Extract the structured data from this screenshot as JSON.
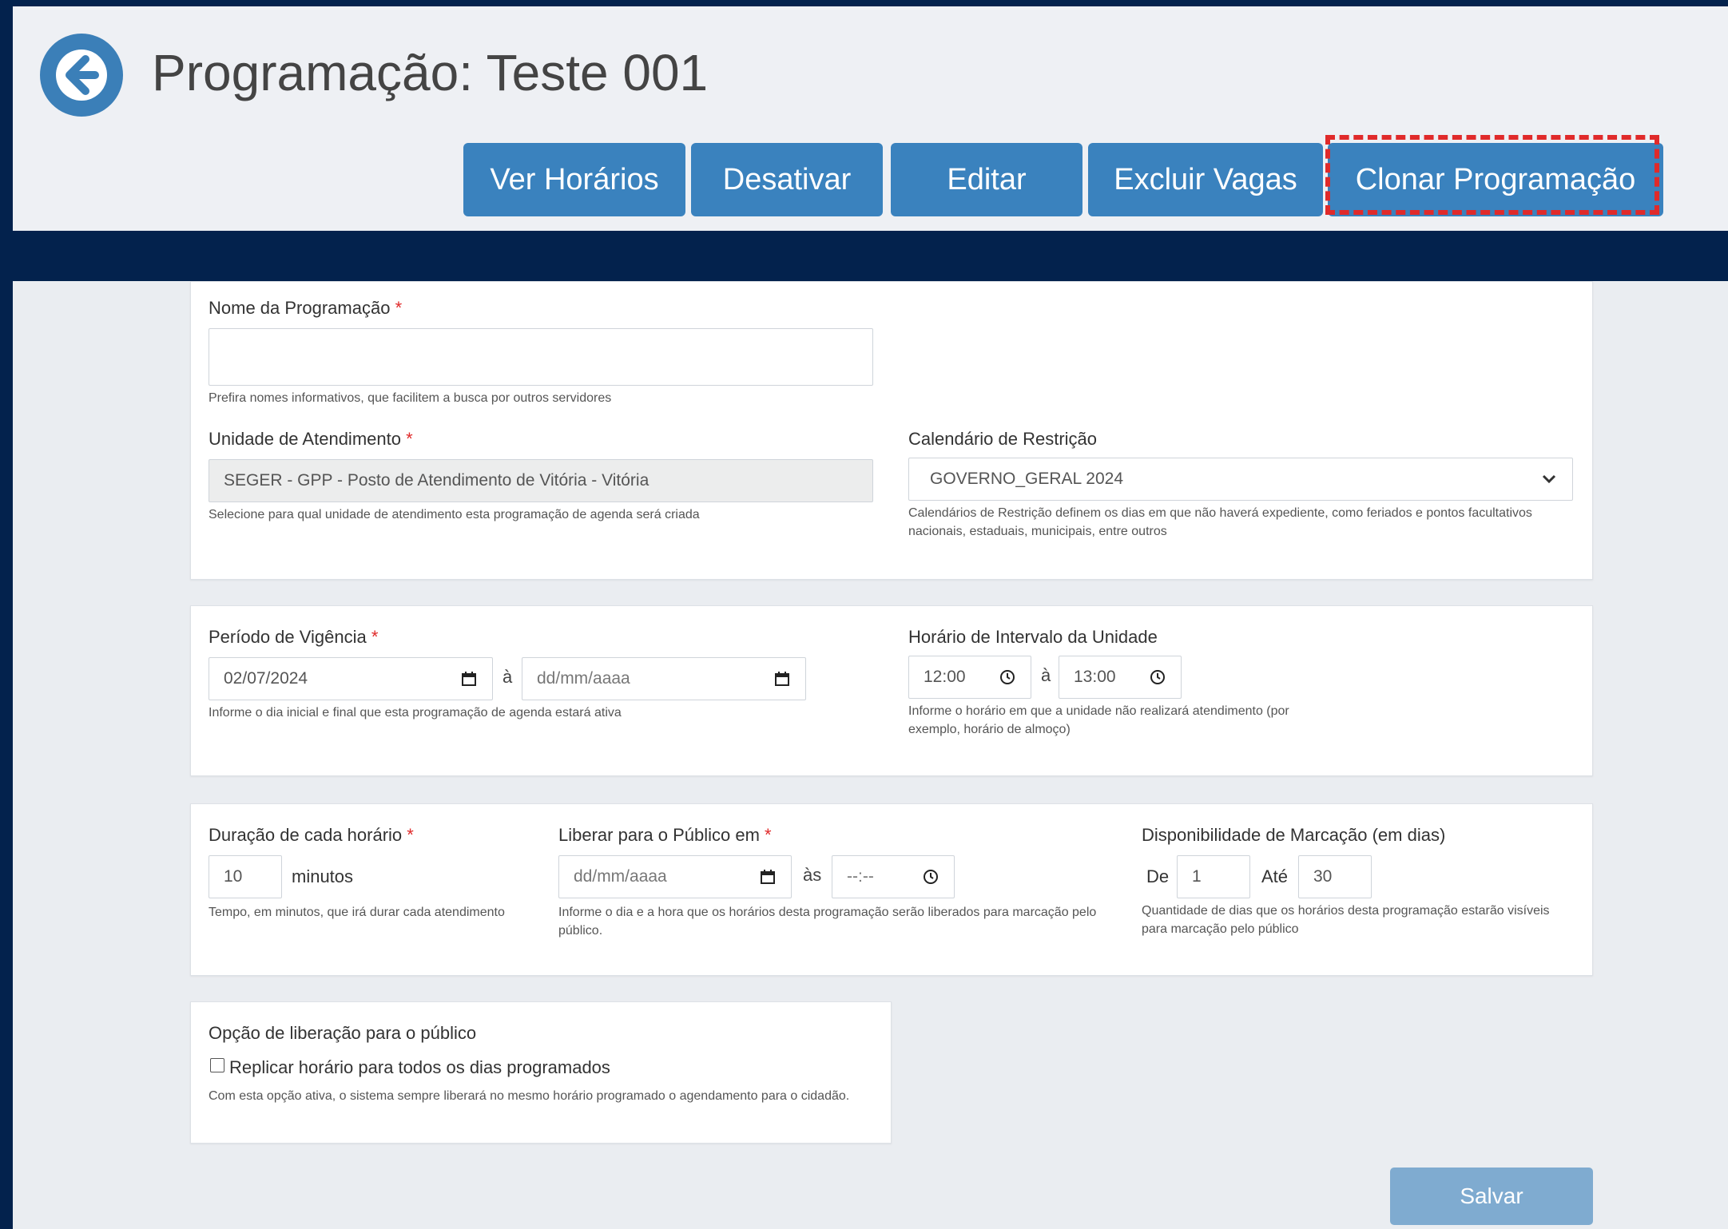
{
  "header": {
    "title": "Programação: Teste 001",
    "buttons": {
      "ver_horarios": "Ver Horários",
      "desativar": "Desativar",
      "editar": "Editar",
      "excluir_vagas": "Excluir Vagas",
      "clonar": "Clonar Programação"
    }
  },
  "form": {
    "nome": {
      "label": "Nome da Programação",
      "value": "",
      "help": "Prefira nomes informativos, que facilitem a busca por outros servidores"
    },
    "unidade": {
      "label": "Unidade de Atendimento",
      "value": "SEGER - GPP - Posto de Atendimento de Vitória - Vitória",
      "help": "Selecione para qual unidade de atendimento esta programação de agenda será criada"
    },
    "calendario": {
      "label": "Calendário de Restrição",
      "selected": "GOVERNO_GERAL 2024",
      "help": "Calendários de Restrição definem os dias em que não haverá expediente, como feriados e pontos facultativos nacionais, estaduais, municipais, entre outros"
    },
    "vigencia": {
      "label": "Período de Vigência",
      "start": "02/07/2024",
      "separator": "à",
      "end_placeholder": "dd/mm/aaaa",
      "help": "Informe o dia inicial e final que esta programação de agenda estará ativa"
    },
    "intervalo": {
      "label": "Horário de Intervalo da Unidade",
      "start": "12:00",
      "separator": "à",
      "end": "13:00",
      "help": "Informe o horário em que a unidade não realizará atendimento (por exemplo, horário de almoço)"
    },
    "duracao": {
      "label": "Duração de cada horário",
      "value": "10",
      "unit": "minutos",
      "help": "Tempo, em minutos, que irá durar cada atendimento"
    },
    "liberar": {
      "label": "Liberar para o Público em",
      "date_placeholder": "dd/mm/aaaa",
      "separator": "às",
      "time_placeholder": "--:--",
      "help": "Informe o dia e a hora que os horários desta programação serão liberados para marcação pelo público."
    },
    "disponibilidade": {
      "label": "Disponibilidade de Marcação (em dias)",
      "de_label": "De",
      "de_value": "1",
      "ate_label": "Até",
      "ate_value": "30",
      "help": "Quantidade de dias que os horários desta programação estarão visíveis para marcação pelo público"
    },
    "opcao": {
      "label": "Opção de liberação para o público",
      "checkbox_label": "Replicar horário para todos os dias programados",
      "checked": false,
      "help": "Com esta opção ativa, o sistema sempre liberará no mesmo horário programado o agendamento para o cidadão."
    },
    "required_mark": "*",
    "save_label": "Salvar"
  },
  "colors": {
    "page_bg": "#03224d",
    "button": "#3a82be",
    "save_button": "#7fabd0",
    "highlight": "#e02a2a"
  }
}
